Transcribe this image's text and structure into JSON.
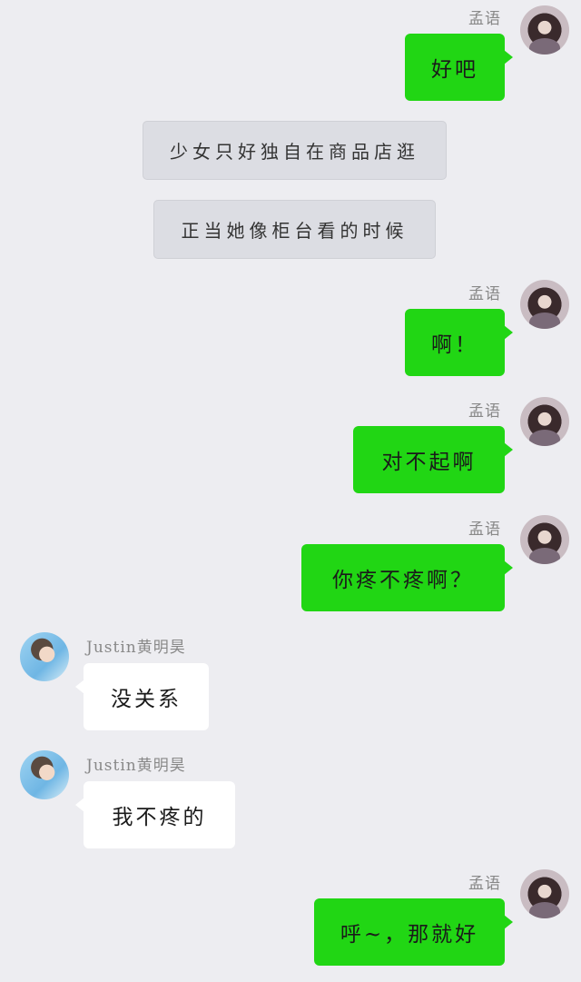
{
  "messages": [
    {
      "sender": "孟语",
      "text": "好吧"
    },
    {
      "narration": "少女只好独自在商品店逛"
    },
    {
      "narration": "正当她像柜台看的时候"
    },
    {
      "sender": "孟语",
      "text": "啊！"
    },
    {
      "sender": "孟语",
      "text": "对不起啊"
    },
    {
      "sender": "孟语",
      "text": "你疼不疼啊？"
    },
    {
      "sender": "Justin黄明昊",
      "text": "没关系"
    },
    {
      "sender": "Justin黄明昊",
      "text": "我不疼的"
    },
    {
      "sender": "孟语",
      "text": "呼~，那就好"
    }
  ],
  "colors": {
    "background": "#ededf1",
    "my_bubble": "#21d614",
    "other_bubble": "#ffffff",
    "narration_bubble": "#dcdde3"
  }
}
